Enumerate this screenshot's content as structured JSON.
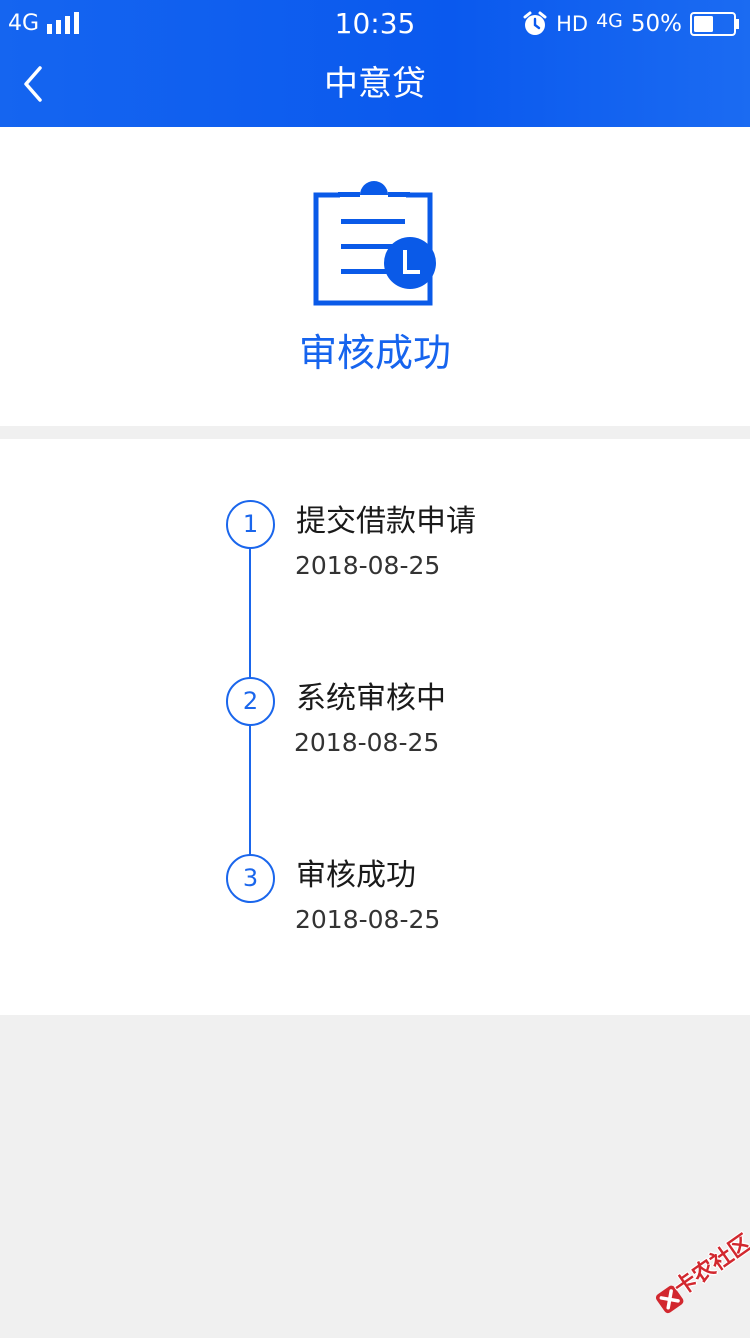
{
  "status_bar": {
    "network": "4G",
    "time": "10:35",
    "hd": "HD",
    "network_secondary": "4G",
    "battery_percent": "50%",
    "battery_level": 0.5
  },
  "nav": {
    "title": "中意贷"
  },
  "hero": {
    "status_text": "审核成功"
  },
  "timeline": {
    "steps": [
      {
        "number": "1",
        "title": "提交借款申请",
        "date": "2018-08-25"
      },
      {
        "number": "2",
        "title": "系统审核中",
        "date": "2018-08-25"
      },
      {
        "number": "3",
        "title": "审核成功",
        "date": "2018-08-25"
      }
    ]
  },
  "watermark": {
    "text": "卡农社区"
  },
  "colors": {
    "accent": "#1664ee",
    "header": "#0a59ee",
    "background": "#f0f0f0",
    "watermark": "#d2282f"
  }
}
